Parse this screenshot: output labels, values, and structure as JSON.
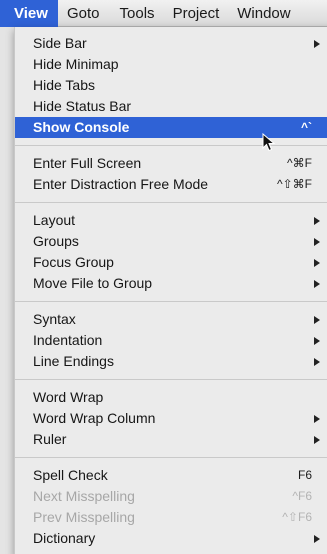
{
  "menubar": {
    "items": [
      "View",
      "Goto",
      "Tools",
      "Project",
      "Window"
    ]
  },
  "menu": {
    "items": [
      {
        "label": "Side Bar",
        "submenu": true
      },
      {
        "label": "Hide Minimap"
      },
      {
        "label": "Hide Tabs"
      },
      {
        "label": "Hide Status Bar"
      },
      {
        "label": "Show Console",
        "shortcut": "^`",
        "highlighted": true
      },
      {
        "label": "Enter Full Screen",
        "shortcut": "^⌘F"
      },
      {
        "label": "Enter Distraction Free Mode",
        "shortcut": "^⇧⌘F"
      },
      {
        "label": "Layout",
        "submenu": true
      },
      {
        "label": "Groups",
        "submenu": true
      },
      {
        "label": "Focus Group",
        "submenu": true
      },
      {
        "label": "Move File to Group",
        "submenu": true
      },
      {
        "label": "Syntax",
        "submenu": true
      },
      {
        "label": "Indentation",
        "submenu": true
      },
      {
        "label": "Line Endings",
        "submenu": true
      },
      {
        "label": "Word Wrap"
      },
      {
        "label": "Word Wrap Column",
        "submenu": true
      },
      {
        "label": "Ruler",
        "submenu": true
      },
      {
        "label": "Spell Check",
        "shortcut": "F6"
      },
      {
        "label": "Next Misspelling",
        "shortcut": "^F6",
        "disabled": true
      },
      {
        "label": "Prev Misspelling",
        "shortcut": "^⇧F6",
        "disabled": true
      },
      {
        "label": "Dictionary",
        "submenu": true
      }
    ]
  },
  "colors": {
    "highlight": "#2f62d6",
    "disabled_text": "#a7a7a7"
  }
}
